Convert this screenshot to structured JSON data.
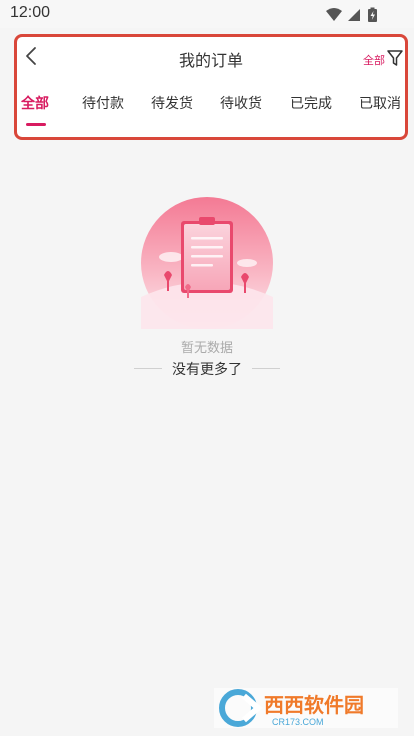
{
  "status_bar": {
    "time": "12:00",
    "icons": [
      "wifi-icon",
      "signal-icon",
      "battery-charging-icon"
    ]
  },
  "header": {
    "title": "我的订单",
    "back_icon": "chevron-left-icon",
    "filter_label": "全部",
    "filter_icon": "funnel-filter-icon"
  },
  "tabs": [
    {
      "label": "全部",
      "active": true
    },
    {
      "label": "待付款",
      "active": false
    },
    {
      "label": "待发货",
      "active": false
    },
    {
      "label": "待收货",
      "active": false
    },
    {
      "label": "已完成",
      "active": false
    },
    {
      "label": "已取消",
      "active": false
    }
  ],
  "empty_state": {
    "illustration": "empty-clipboard-illustration",
    "message": "暂无数据",
    "footer": "没有更多了"
  },
  "watermark": {
    "brand": "西西软件园",
    "domain": "CR173.COM"
  },
  "colors": {
    "accent": "#d81b60",
    "highlight_border": "#d9473a",
    "background": "#f5f5f5"
  }
}
